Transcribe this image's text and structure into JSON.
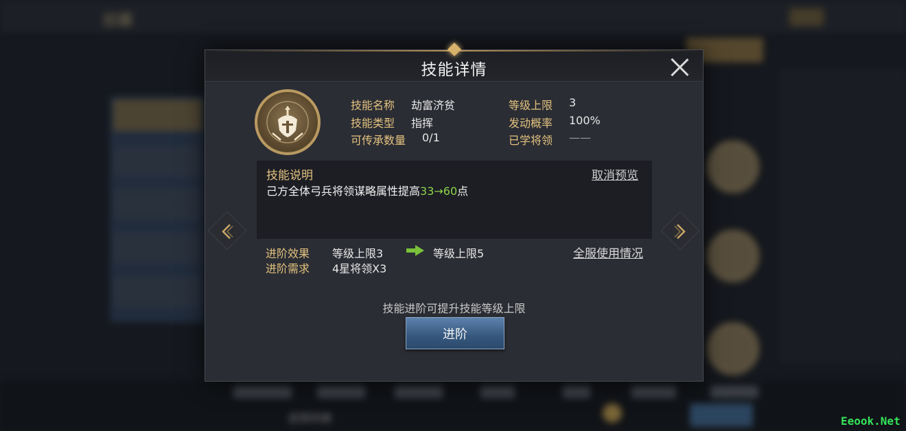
{
  "background": {
    "title": "招募",
    "bottom_left_label": "武将列表"
  },
  "modal": {
    "title": "技能详情",
    "info": {
      "skill_name_label": "技能名称",
      "skill_name": "劫富济贫",
      "skill_type_label": "技能类型",
      "skill_type": "指挥",
      "inherit_count_label": "可传承数量",
      "inherit_count": "0/1",
      "level_cap_label": "等级上限",
      "level_cap": "3",
      "trigger_rate_label": "发动概率",
      "trigger_rate": "100%",
      "learned_by_label": "已学将领",
      "learned_by": "——"
    },
    "description": {
      "title": "技能说明",
      "cancel_preview": "取消预览",
      "text_prefix": "己方全体弓兵将领谋略属性提高",
      "text_highlight": "33→60",
      "text_suffix": "点"
    },
    "advance": {
      "effect_label": "进阶效果",
      "effect_from": "等级上限3",
      "effect_to": "等级上限5",
      "requirement_label": "进阶需求",
      "requirement": "4星将领X3",
      "server_usage": "全服使用情况",
      "hint": "技能进阶可提升技能等级上限",
      "button": "进阶"
    }
  },
  "watermark": "Eeook.Net",
  "colors": {
    "gold_label": "#e3c27f",
    "highlight_green": "#8fd34a",
    "button_blue": "#36577d",
    "modal_bg": "#2b2d34"
  },
  "icons": {
    "skill": "shield-helmet-icon",
    "close": "close-icon",
    "prev": "chevron-left-icon",
    "next": "chevron-right-icon",
    "arrow": "green-arrow-right-icon"
  }
}
